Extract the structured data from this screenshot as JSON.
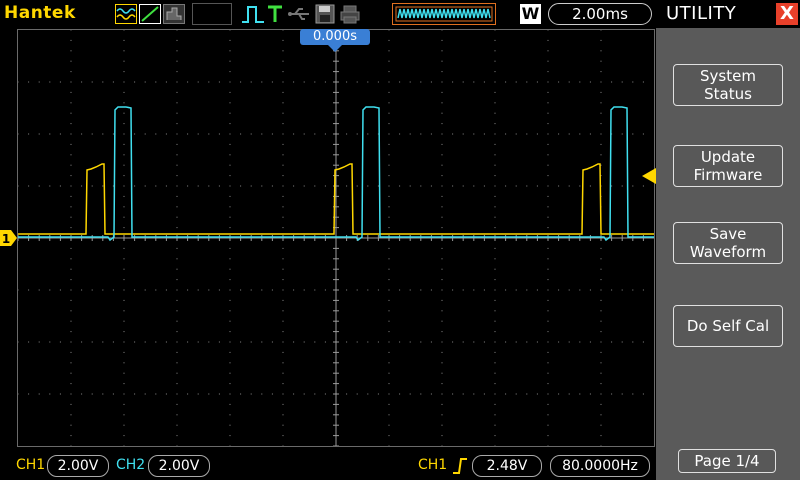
{
  "brand": "Hantek",
  "toolbar": {
    "icons": [
      "acquire-mode-icon",
      "line-display-icon",
      "persistence-icon",
      "run-status-icon",
      "trigger-t-icon",
      "usb-icon",
      "save-icon",
      "print-icon"
    ],
    "window_mode": "W",
    "timebase": "2.00ms"
  },
  "trigger_position": "0.000s",
  "menu": {
    "title": "UTILITY",
    "close_label": "X",
    "items": [
      {
        "line1": "System",
        "line2": "Status"
      },
      {
        "line1": "Update",
        "line2": "Firmware"
      },
      {
        "line1": "Save",
        "line2": "Waveform"
      },
      {
        "line1": "Do Self Cal",
        "line2": ""
      }
    ],
    "page": "Page 1/4"
  },
  "status": {
    "ch1_label": "CH1",
    "ch1_scale": "2.00V",
    "ch2_label": "CH2",
    "ch2_scale": "2.00V",
    "trigger_source": "CH1",
    "trigger_level": "2.48V",
    "trigger_frequency": "80.0000Hz"
  },
  "colors": {
    "ch1": "#ffd700",
    "ch2": "#40e0f0",
    "accent": "#3a7fd5",
    "close": "#e8402a"
  },
  "channel_markers": {
    "ch1_ground_label": "1"
  }
}
